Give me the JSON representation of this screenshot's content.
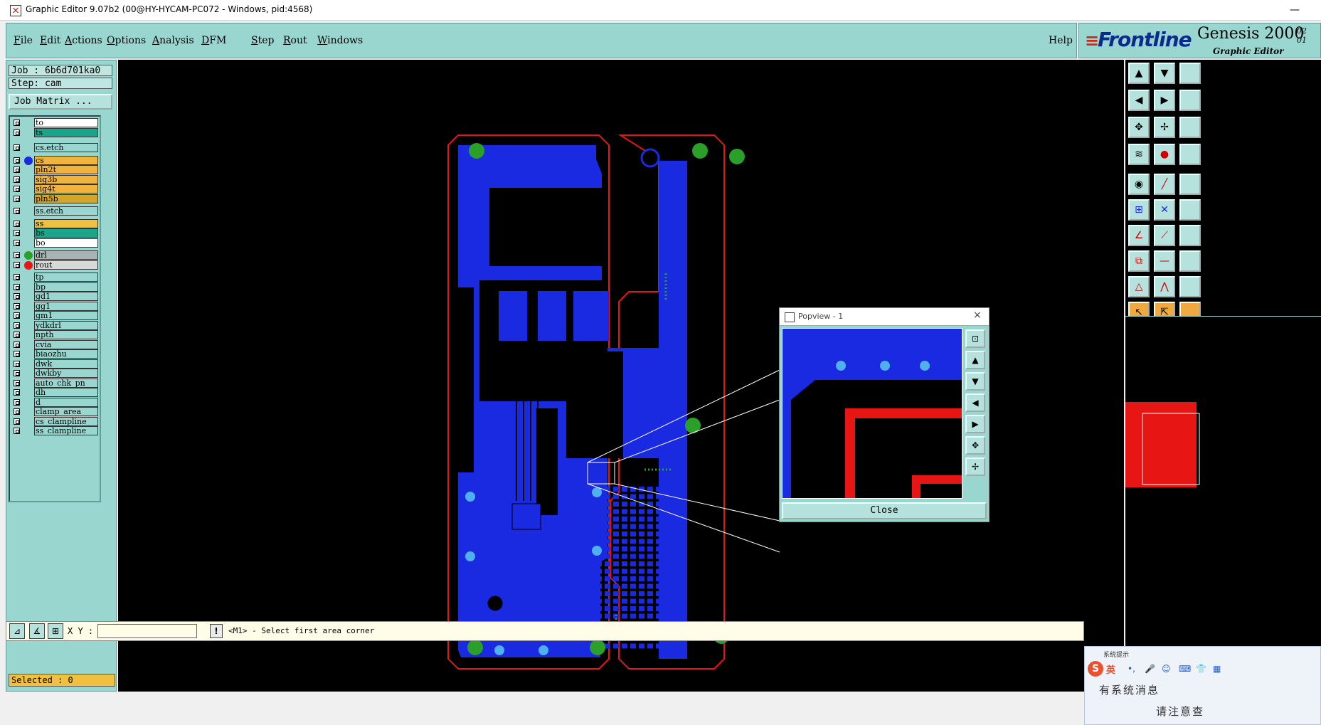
{
  "window": {
    "title": "Graphic Editor 9.07b2 (00@HY-HYCAM-PC072 - Windows, pid:4568)",
    "minimize": "—"
  },
  "menu": {
    "items": [
      "File",
      "Edit",
      "Actions",
      "Options",
      "Analysis",
      "DFM",
      "Step",
      "Rout",
      "Windows"
    ],
    "help": "Help"
  },
  "logo": {
    "brand": "Frontline",
    "product": "Genesis 2000",
    "subtitle": "Graphic Editor",
    "version_top": "02",
    "version_bottom": "01"
  },
  "job": {
    "job_label": "Job : 6b6d701ka0",
    "step_label": "Step: cam",
    "matrix_button": "Job Matrix ..."
  },
  "layers": [
    {
      "name": "to",
      "color": "#ffffff",
      "dot": ""
    },
    {
      "name": "ts",
      "color": "#1aa58a",
      "dot": ""
    },
    {
      "name": "cs.etch",
      "color": "#9ad6d0",
      "dot": ""
    },
    {
      "name": "cs",
      "color": "#f0b43c",
      "dot": "#1a2ae0"
    },
    {
      "name": "pln2t",
      "color": "#f0b43c",
      "dot": ""
    },
    {
      "name": "sig3b",
      "color": "#f0b43c",
      "dot": ""
    },
    {
      "name": "sig4t",
      "color": "#f0b43c",
      "dot": ""
    },
    {
      "name": "pln5b",
      "color": "#d4a52a",
      "dot": ""
    },
    {
      "name": "ss.etch",
      "color": "#9ad6d0",
      "dot": ""
    },
    {
      "name": "ss",
      "color": "#f0c040",
      "dot": ""
    },
    {
      "name": "bs",
      "color": "#1aa58a",
      "dot": ""
    },
    {
      "name": "bo",
      "color": "#ffffff",
      "dot": ""
    },
    {
      "name": "drl",
      "color": "#a8b4b4",
      "dot": "#2aa02a"
    },
    {
      "name": "rout",
      "color": "#d8d8d8",
      "dot": "#e81515"
    },
    {
      "name": "tp",
      "color": "#9ad6d0",
      "dot": ""
    },
    {
      "name": "bp",
      "color": "#9ad6d0",
      "dot": ""
    },
    {
      "name": "gd1",
      "color": "#9ad6d0",
      "dot": ""
    },
    {
      "name": "gg1",
      "color": "#9ad6d0",
      "dot": ""
    },
    {
      "name": "gm1",
      "color": "#9ad6d0",
      "dot": ""
    },
    {
      "name": "ydkdrl",
      "color": "#9ad6d0",
      "dot": ""
    },
    {
      "name": "npth",
      "color": "#9ad6d0",
      "dot": ""
    },
    {
      "name": "cvia",
      "color": "#9ad6d0",
      "dot": ""
    },
    {
      "name": "biaozhu",
      "color": "#9ad6d0",
      "dot": ""
    },
    {
      "name": "dwk",
      "color": "#9ad6d0",
      "dot": ""
    },
    {
      "name": "dwkby",
      "color": "#9ad6d0",
      "dot": ""
    },
    {
      "name": "auto_chk_pn",
      "color": "#9ad6d0",
      "dot": ""
    },
    {
      "name": "dh",
      "color": "#9ad6d0",
      "dot": ""
    },
    {
      "name": "d",
      "color": "#9ad6d0",
      "dot": ""
    },
    {
      "name": "clamp_area",
      "color": "#9ad6d0",
      "dot": ""
    },
    {
      "name": "cs_clampline",
      "color": "#9ad6d0",
      "dot": ""
    },
    {
      "name": "ss_clampline",
      "color": "#9ad6d0",
      "dot": ""
    }
  ],
  "selected": "Selected : 0",
  "popview": {
    "title": "Popview - 1",
    "close_label": "Close",
    "close_x": "×"
  },
  "status": {
    "xy_label": "X Y :",
    "xy_value": "",
    "bang": "!",
    "prompt": "<M1> - Select first area corner"
  },
  "ime": {
    "header": "系统提示",
    "mode": "英",
    "message1": "有系统消息",
    "message2": "请注意查"
  },
  "colors": {
    "panel": "#9ad6d0",
    "copper": "#1a2ae0",
    "outline": "#e81515",
    "drill": "#2aa02a",
    "canvas": "#000000"
  }
}
